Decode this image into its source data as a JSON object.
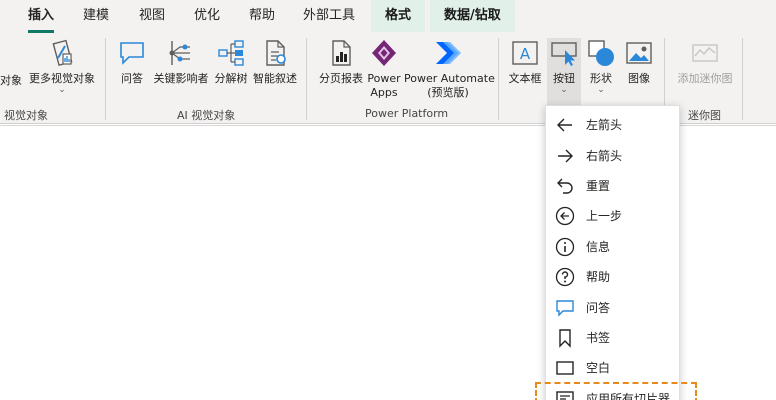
{
  "tabs": [
    {
      "label": "插入",
      "active": true
    },
    {
      "label": "建模"
    },
    {
      "label": "视图"
    },
    {
      "label": "优化"
    },
    {
      "label": "帮助"
    },
    {
      "label": "外部工具"
    },
    {
      "label": "格式",
      "contextual": true
    },
    {
      "label": "数据/钻取",
      "contextual": true
    }
  ],
  "ribbon": {
    "buttons": {
      "visual_cut": "对象",
      "more_visuals": "更多视觉对象",
      "qa": "问答",
      "key_influencers": "关键影响者",
      "decomposition_tree": "分解树",
      "smart_narrative": "智能叙述",
      "paginated_report": "分页报表",
      "power_apps_1": "Power",
      "power_apps_2": "Apps",
      "power_automate_1": "Power Automate",
      "power_automate_2": "(预览版)",
      "text_box": "文本框",
      "buttons": "按钮",
      "shapes": "形状",
      "image": "图像",
      "add_sparkline": "添加迷你图"
    },
    "groups": {
      "visuals": "视觉对象",
      "ai_visuals": "AI 视觉对象",
      "power_platform": "Power Platform",
      "sparklines": "迷你图"
    }
  },
  "menu": {
    "items": [
      {
        "label": "左箭头",
        "icon": "arrow-left-icon"
      },
      {
        "label": "右箭头",
        "icon": "arrow-right-icon"
      },
      {
        "label": "重置",
        "icon": "reset-icon"
      },
      {
        "label": "上一步",
        "icon": "back-circle-icon"
      },
      {
        "label": "信息",
        "icon": "info-icon"
      },
      {
        "label": "帮助",
        "icon": "help-icon"
      },
      {
        "label": "问答",
        "icon": "qa-icon"
      },
      {
        "label": "书签",
        "icon": "bookmark-icon"
      },
      {
        "label": "空白",
        "icon": "blank-icon"
      },
      {
        "label": "应用所有切片器",
        "icon": "apply-slicers-icon"
      }
    ]
  },
  "colors": {
    "accent": "#117865",
    "icon_blue": "#2b88d8",
    "highlight": "#e8891c",
    "context_tab_bg": "#e1f0e8"
  }
}
